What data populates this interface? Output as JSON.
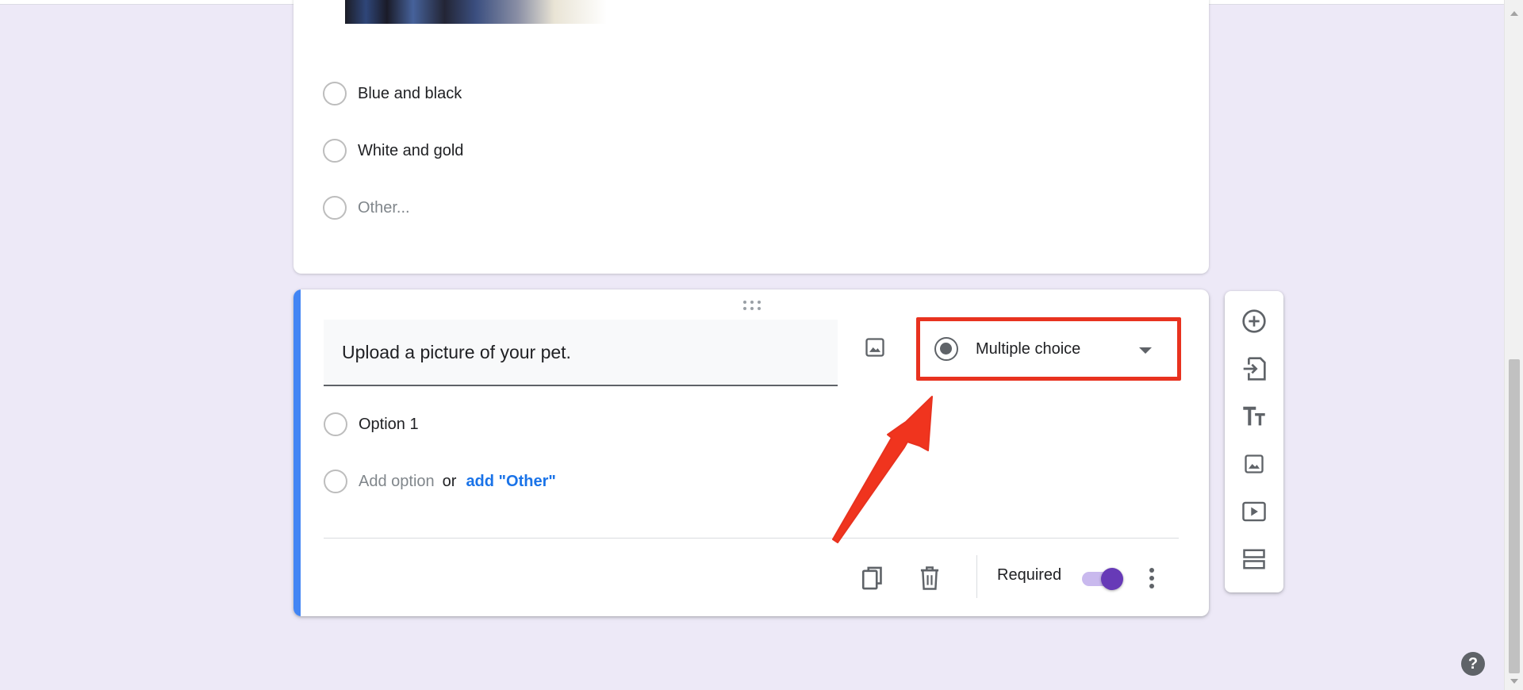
{
  "previous_question": {
    "options": [
      {
        "label": "Blue and black",
        "muted": false
      },
      {
        "label": "White and gold",
        "muted": false
      },
      {
        "label": "Other...",
        "muted": true
      }
    ]
  },
  "active_question": {
    "title": "Upload a picture of your pet.",
    "question_type": "Multiple choice",
    "options": [
      {
        "label": "Option 1"
      }
    ],
    "add_option_label": "Add option",
    "or_label": "or",
    "add_other_label": "add \"Other\"",
    "required_label": "Required",
    "required_on": true
  },
  "side_toolbar": {
    "items": [
      {
        "icon": "add-circle-icon"
      },
      {
        "icon": "import-questions-icon"
      },
      {
        "icon": "title-text-icon"
      },
      {
        "icon": "image-icon"
      },
      {
        "icon": "video-icon"
      },
      {
        "icon": "section-icon"
      }
    ]
  },
  "help": {
    "label": "?"
  },
  "colors": {
    "background": "#ede9f7",
    "accent_bar": "#4285f4",
    "toggle_knob": "#673ab7",
    "annotation": "#e8321f",
    "link": "#1a73e8"
  }
}
